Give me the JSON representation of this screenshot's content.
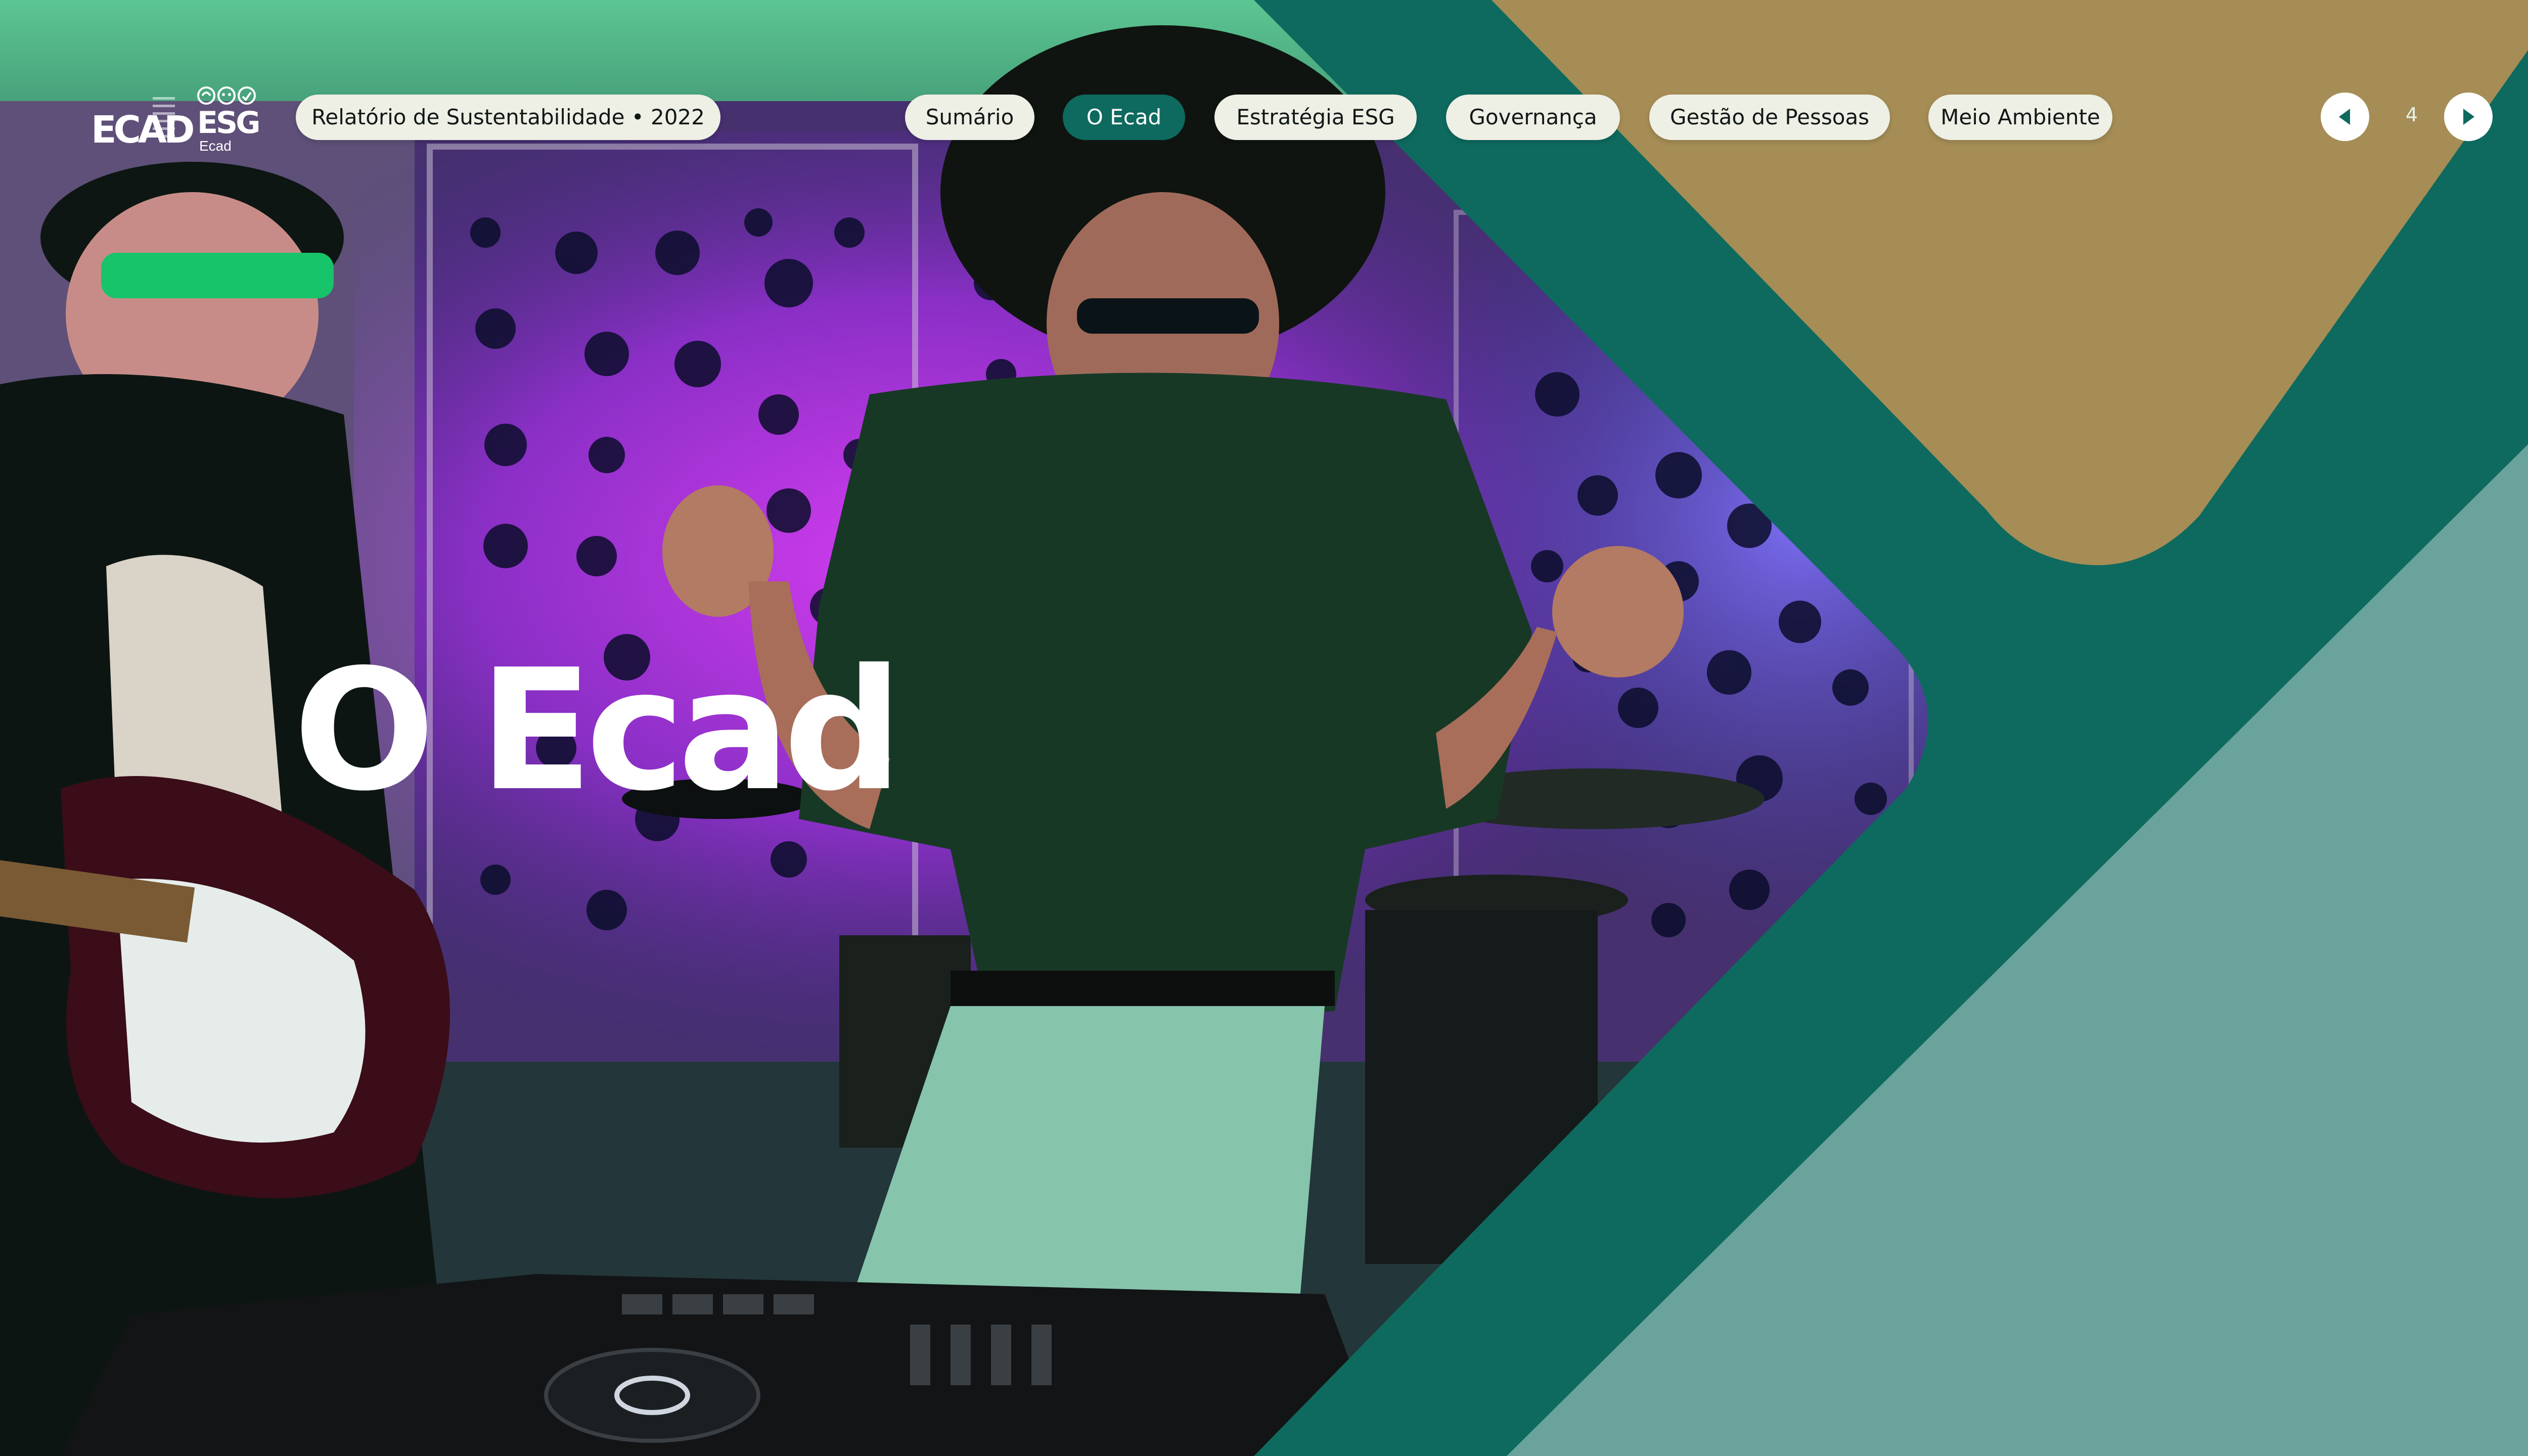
{
  "header": {
    "logo_ecad": "ECAD",
    "logo_esg": {
      "title": "ESG",
      "subtitle": "Ecad"
    },
    "report_label": "Relatório de Sustentabilidade • 2022"
  },
  "nav": {
    "items": [
      {
        "label": "Sumário",
        "active": false
      },
      {
        "label": "O Ecad",
        "active": true
      },
      {
        "label": "Estratégia ESG",
        "active": false
      },
      {
        "label": "Governança",
        "active": false
      },
      {
        "label": "Gestão de Pessoas",
        "active": false
      },
      {
        "label": "Meio Ambiente",
        "active": false
      }
    ]
  },
  "pager": {
    "current_page": "4"
  },
  "hero": {
    "title": "O Ecad"
  },
  "colors": {
    "dark_teal": "#0e6a5e",
    "gold": "#a58d55",
    "sage_teal": "#6aa29c",
    "pill_bg": "#eeefe5",
    "active_pill": "#0e6a5e"
  },
  "icons": [
    "ecad-logo",
    "esg-logo",
    "prev-arrow-icon",
    "next-arrow-icon"
  ]
}
